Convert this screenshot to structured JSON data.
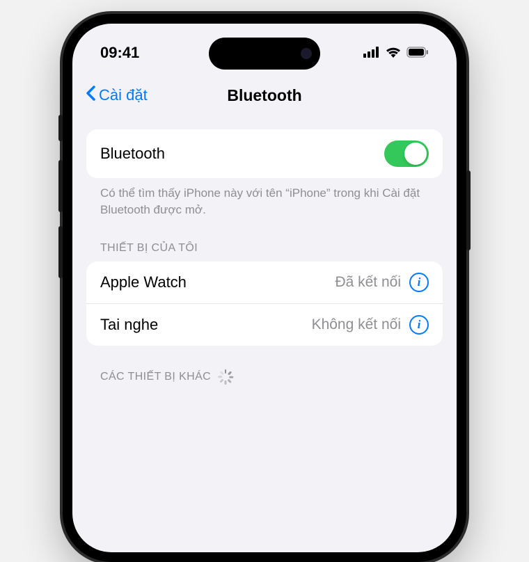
{
  "status_bar": {
    "time": "09:41"
  },
  "nav": {
    "back_label": "Cài đặt",
    "title": "Bluetooth"
  },
  "bluetooth_toggle": {
    "label": "Bluetooth",
    "on": true
  },
  "discoverable_hint": "Có thể tìm thấy iPhone này với tên “iPhone” trong khi Cài đặt Bluetooth được mở.",
  "sections": {
    "my_devices": {
      "header": "THIẾT BỊ CỦA TÔI",
      "items": [
        {
          "name": "Apple Watch",
          "status": "Đã kết nối"
        },
        {
          "name": "Tai nghe",
          "status": "Không kết nối"
        }
      ]
    },
    "other_devices": {
      "header": "CÁC THIẾT BỊ KHÁC",
      "scanning": true
    }
  },
  "colors": {
    "accent": "#007aff",
    "toggle_on": "#34c759",
    "secondary_text": "#8e8e93",
    "bg": "#f2f2f7"
  }
}
